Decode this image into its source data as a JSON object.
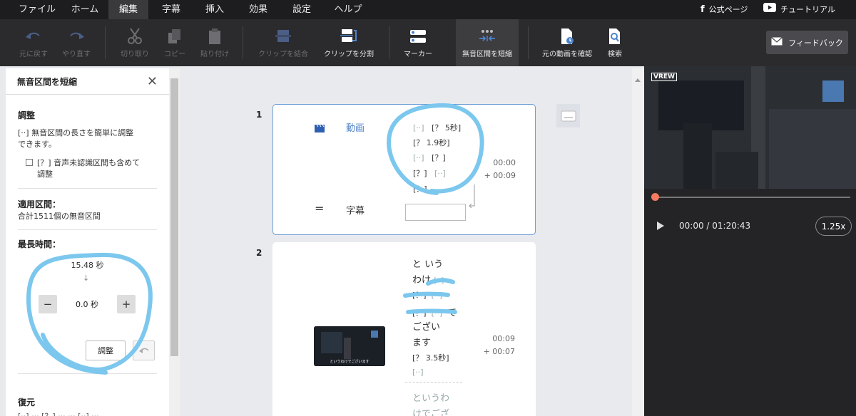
{
  "menu": {
    "items": [
      "ファイル",
      "ホーム",
      "編集",
      "字幕",
      "挿入",
      "効果",
      "設定",
      "ヘルプ"
    ],
    "active_index": 2,
    "official_page": "公式ページ",
    "tutorial": "チュートリアル"
  },
  "toolbar": {
    "undo": "元に戻す",
    "redo": "やり直す",
    "cut": "切り取り",
    "copy": "コピー",
    "paste": "貼り付け",
    "merge_clips": "クリップを結合",
    "split_clip": "クリップを分割",
    "marker": "マーカー",
    "shorten_silence": "無音区間を短縮",
    "check_original": "元の動画を確認",
    "search": "検索",
    "feedback": "フィードバック"
  },
  "panel": {
    "title": "無音区間を短縮",
    "adjust_title": "調整",
    "adjust_desc_1": "[··] 無音区間の長さを簡単に調整",
    "adjust_desc_2": "できます。",
    "checkbox_label_1": "[？] 音声未認識区間も含めて",
    "checkbox_label_2": "調整",
    "applied_title": "適用区間：",
    "applied_value": "合計1511個の無音区間",
    "max_title": "最長時間：",
    "max_value": "15.48 秒",
    "arrow": "↓",
    "minus": "−",
    "plus": "+",
    "input_value": "0.0 秒",
    "adjust_button": "調整",
    "restore_title": "復元"
  },
  "clips": [
    {
      "number": "1",
      "video_label": "動画",
      "subtitle_label": "字幕",
      "equals": "=",
      "lines": [
        [
          "[··]",
          "[？ 5秒]"
        ],
        [
          "[？ 1.9秒]"
        ],
        [
          "[··]",
          "[？]"
        ],
        [
          "[？]",
          "[··]"
        ],
        [
          "[？]"
        ]
      ],
      "time_start": "00:00",
      "time_dur": "+ 00:09"
    },
    {
      "number": "2",
      "lines": [
        "と いう",
        "わけ",
        "[？]",
        "[？]",
        "で",
        "ござい",
        "ます",
        "[？ 3.5秒]",
        "[··]"
      ],
      "line2_tags": [
        "[··]",
        "[··]",
        "[··]"
      ],
      "sub_lines": [
        "というわ",
        "けでござ"
      ],
      "thumb_caption": "というわけでございます",
      "time_start": "00:09",
      "time_dur": "+ 00:07"
    }
  ],
  "preview": {
    "logo": "VREW",
    "progress": 0,
    "time": "00:00 / 01:20:43",
    "speed": "1.25x"
  },
  "colors": {
    "accent": "#4e83c9",
    "annotation": "#7cc7ee",
    "knob": "#f47a62"
  }
}
